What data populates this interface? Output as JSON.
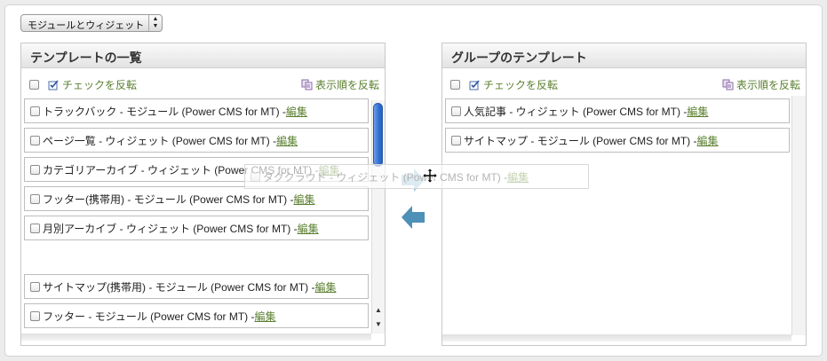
{
  "selector": {
    "value": "モジュールとウィジェット"
  },
  "left_panel": {
    "title": "テンプレートの一覧",
    "invert_check": "チェックを反転",
    "reverse_order": "表示順を反転",
    "items": [
      {
        "label": "トラックバック - モジュール (Power CMS for MT) - ",
        "edit": "編集"
      },
      {
        "label": "ページ一覧 - ウィジェット (Power CMS for MT) - ",
        "edit": "編集"
      },
      {
        "label": "カテゴリアーカイブ - ウィジェット (Power CMS for MT) - ",
        "edit": "編集"
      },
      {
        "label": "フッター(携帯用) - モジュール (Power CMS for MT) - ",
        "edit": "編集"
      },
      {
        "label": "月別アーカイブ - ウィジェット (Power CMS for MT) - ",
        "edit": "編集"
      },
      {
        "label": "サイトマップ(携帯用) - モジュール (Power CMS for MT) - ",
        "edit": "編集"
      },
      {
        "label": "フッター - モジュール (Power CMS for MT) - ",
        "edit": "編集"
      }
    ]
  },
  "right_panel": {
    "title": "グループのテンプレート",
    "invert_check": "チェックを反転",
    "reverse_order": "表示順を反転",
    "items": [
      {
        "label": "人気記事 - ウィジェット (Power CMS for MT) - ",
        "edit": "編集"
      },
      {
        "label": "サイトマップ - モジュール (Power CMS for MT) - ",
        "edit": "編集"
      }
    ]
  },
  "dragging_item": {
    "label": "タグクラウド - ウィジェット (Power CMS for MT) - ",
    "edit": "編集"
  },
  "colors": {
    "link": "#5b7f2f",
    "arrow": "#4d90b8",
    "scroll_thumb": "#2f6fd3"
  }
}
